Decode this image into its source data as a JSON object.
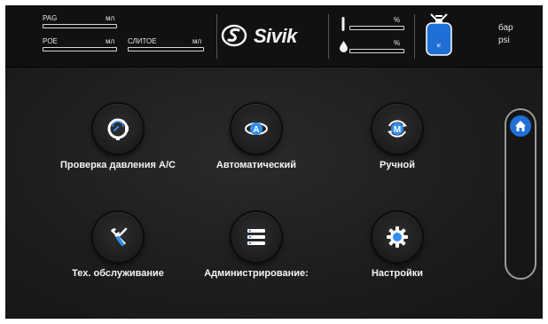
{
  "header": {
    "pag_label": "PAG",
    "pag_unit": "мл",
    "poe_label": "POE",
    "poe_unit": "мл",
    "dye_label": "СЛИТОЕ",
    "dye_unit": "мл",
    "brand": "Sivik",
    "percent_top": "%",
    "percent_bottom": "%",
    "tank_unit": "кг",
    "pressure_unit_1": "бар",
    "pressure_unit_2": "psi"
  },
  "menu": {
    "items": [
      {
        "label": "Проверка давления А/С",
        "icon": "gauge-icon"
      },
      {
        "label": "Автоматический",
        "icon": "auto-icon"
      },
      {
        "label": "Ручной",
        "icon": "manual-icon"
      },
      {
        "label": "Тех. обслуживание",
        "icon": "wrench-icon"
      },
      {
        "label": "Администрирование:",
        "icon": "list-icon"
      },
      {
        "label": "Настройки",
        "icon": "gear-icon"
      }
    ],
    "auto_icon_letter": "A",
    "manual_icon_letter": "M"
  },
  "side": {
    "home_icon": "home-icon"
  },
  "colors": {
    "accent": "#1f6fd6",
    "background": "#1a1a1a",
    "text": "#f4f4f4"
  }
}
